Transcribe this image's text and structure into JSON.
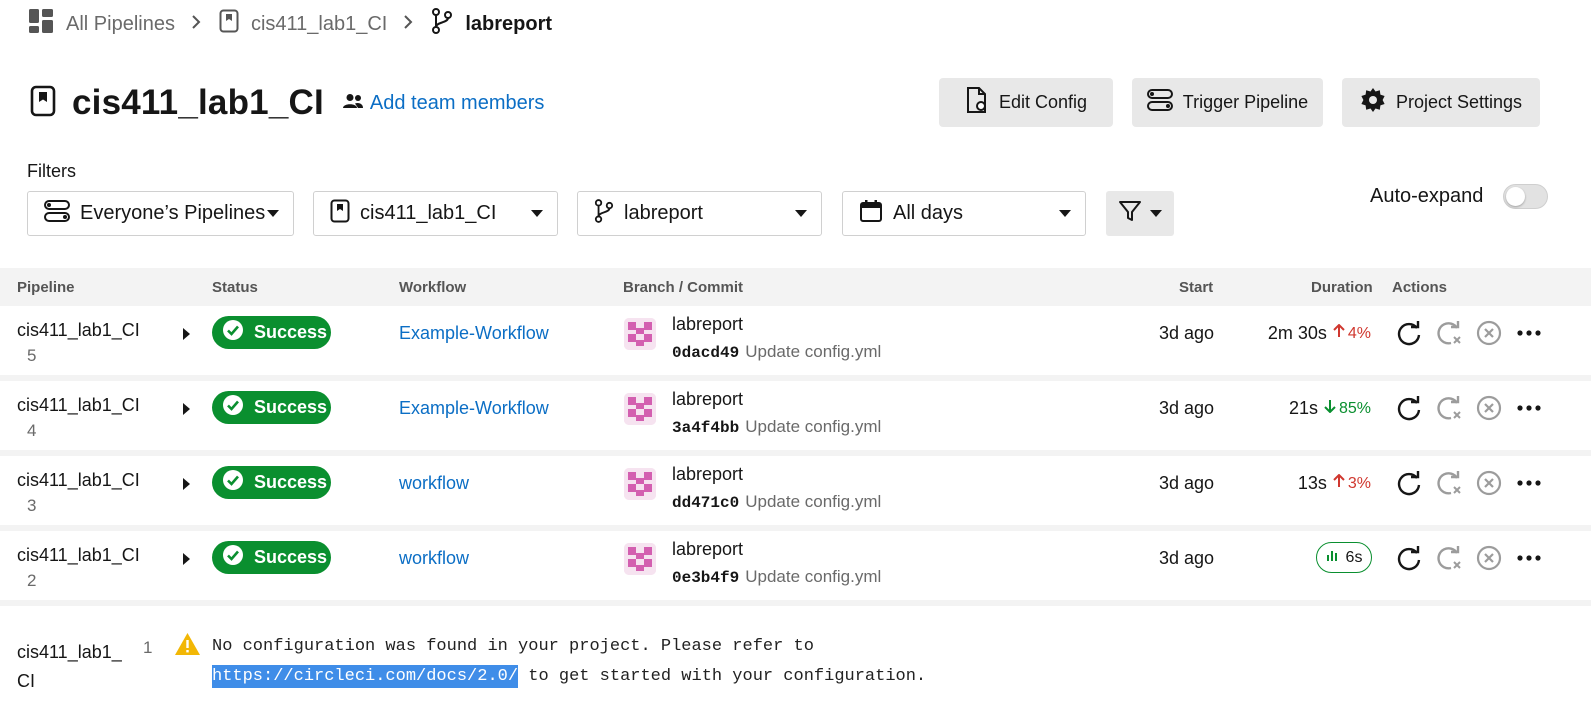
{
  "breadcrumb": {
    "items": [
      "All Pipelines",
      "cis411_lab1_CI",
      "labreport"
    ]
  },
  "header": {
    "title": "cis411_lab1_CI",
    "add_team_label": "Add team members",
    "buttons": {
      "edit_config": "Edit Config",
      "trigger_pipeline": "Trigger Pipeline",
      "project_settings": "Project Settings"
    }
  },
  "filters": {
    "label": "Filters",
    "pipelines": "Everyone’s Pipelines",
    "project": "cis411_lab1_CI",
    "branch": "labreport",
    "days": "All days",
    "auto_expand_label": "Auto-expand",
    "auto_expand_on": false
  },
  "table": {
    "columns": {
      "pipeline": "Pipeline",
      "status": "Status",
      "workflow": "Workflow",
      "branch_commit": "Branch / Commit",
      "start": "Start",
      "duration": "Duration",
      "actions": "Actions"
    },
    "rows": [
      {
        "name": "cis411_lab1_CI",
        "number": "5",
        "status": "Success",
        "workflow": "Example-Workflow",
        "branch": "labreport",
        "hash": "0dacd49",
        "message": "Update config.yml",
        "start": "3d ago",
        "duration": "2m 30s",
        "change": "4%",
        "change_dir": "up"
      },
      {
        "name": "cis411_lab1_CI",
        "number": "4",
        "status": "Success",
        "workflow": "Example-Workflow",
        "branch": "labreport",
        "hash": "3a4f4bb",
        "message": "Update config.yml",
        "start": "3d ago",
        "duration": "21s",
        "change": "85%",
        "change_dir": "down"
      },
      {
        "name": "cis411_lab1_CI",
        "number": "3",
        "status": "Success",
        "workflow": "workflow",
        "branch": "labreport",
        "hash": "dd471c0",
        "message": "Update config.yml",
        "start": "3d ago",
        "duration": "13s",
        "change": "3%",
        "change_dir": "up"
      },
      {
        "name": "cis411_lab1_CI",
        "number": "2",
        "status": "Success",
        "workflow": "workflow",
        "branch": "labreport",
        "hash": "0e3b4f9",
        "message": "Update config.yml",
        "start": "3d ago",
        "duration": "6s",
        "change": "",
        "change_dir": "badge"
      }
    ],
    "error_row": {
      "name": "cis411_lab1_CI",
      "number": "1",
      "message_line1": "No configuration was found in your project. Please refer to",
      "link": "https://circleci.com/docs/2.0/",
      "message_line2": " to get started with your configuration."
    }
  },
  "colors": {
    "success": "#0a8f2f",
    "link": "#0b6ec5",
    "up": "#d0382f",
    "down": "#0a8f2f",
    "warning": "#f2b705"
  },
  "icons": {
    "breadcrumb": [
      "grid-icon",
      "project-icon",
      "branch-icon"
    ],
    "header": [
      "project-icon",
      "team-icon",
      "config-file-icon",
      "trigger-icon",
      "gear-icon"
    ],
    "actions": [
      "rerun-icon",
      "rerun-failed-icon",
      "cancel-icon",
      "more-icon"
    ]
  }
}
